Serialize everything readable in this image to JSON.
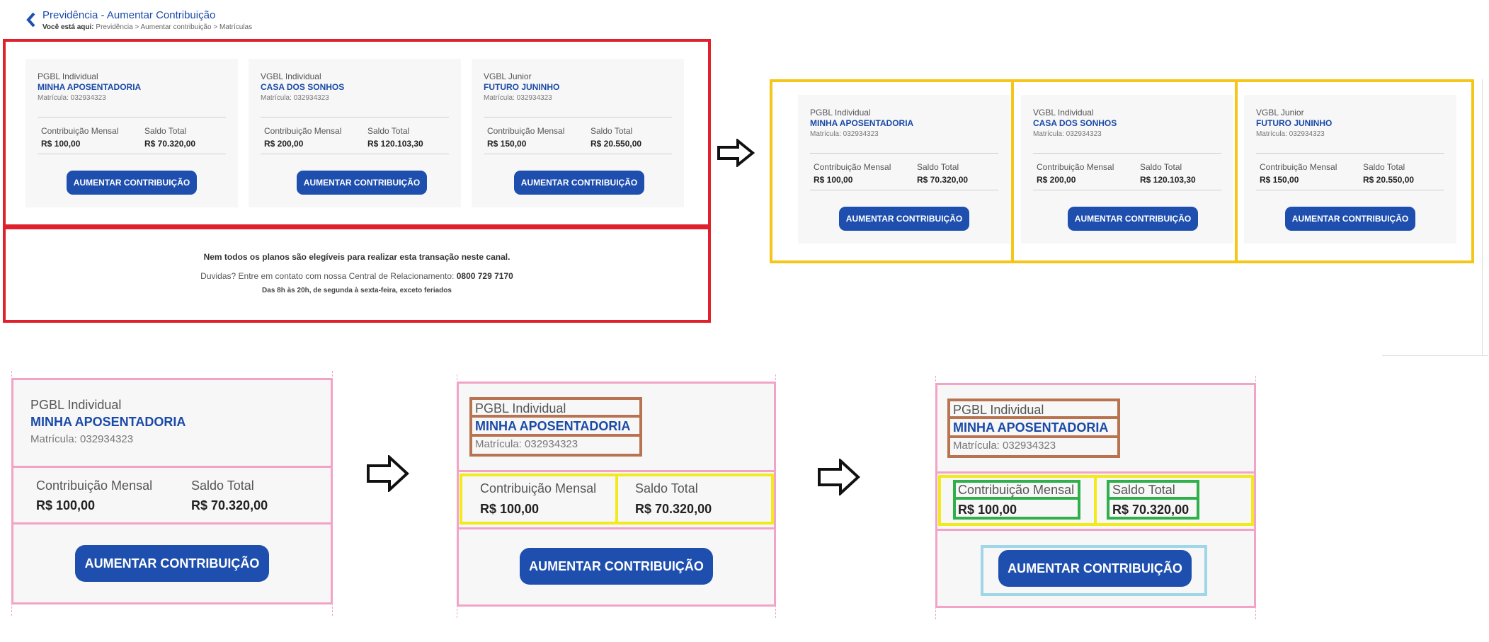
{
  "header": {
    "title": "Previdência - Aumentar Contribuição",
    "breadcrumb_prefix": "Você está aqui:",
    "breadcrumb_path": "Previdência > Aumentar contribuição > Matrículas"
  },
  "plans": [
    {
      "type": "PGBL Individual",
      "name": "MINHA APOSENTADORIA",
      "matricula": "Matrícula: 032934323",
      "contrib_label": "Contribuição Mensal",
      "contrib_value": "R$ 100,00",
      "saldo_label": "Saldo Total",
      "saldo_value": "R$ 70.320,00",
      "button": "AUMENTAR CONTRIBUIÇÃO"
    },
    {
      "type": "VGBL Individual",
      "name": "CASA DOS SONHOS",
      "matricula": "Matrícula: 032934323",
      "contrib_label": "Contribuição Mensal",
      "contrib_value": "R$ 200,00",
      "saldo_label": "Saldo Total",
      "saldo_value": "R$ 120.103,30",
      "button": "AUMENTAR CONTRIBUIÇÃO"
    },
    {
      "type": "VGBL Junior",
      "name": "FUTURO JUNINHO",
      "matricula": "Matrícula: 032934323",
      "contrib_label": "Contribuição Mensal",
      "contrib_value": "R$ 150,00",
      "saldo_label": "Saldo Total",
      "saldo_value": "R$ 20.550,00",
      "button": "AUMENTAR CONTRIBUIÇÃO"
    }
  ],
  "footer": {
    "notice": "Nem todos os planos são elegíveis para realizar esta transação neste canal.",
    "contact_prefix": "Duvidas? Entre em contato com nossa Central de Relacionamento:",
    "phone": "0800 729 7170",
    "hours": "Das 8h às 20h, de segunda à sexta-feira, exceto feriados"
  },
  "icons": {
    "back": "chevron-left-icon",
    "arrow": "arrow-right-icon"
  },
  "colors": {
    "brand_blue": "#1e4fae",
    "red_box": "#e0202a",
    "yellow_box": "#f5c518",
    "pink_box": "#f2a3c7",
    "brown_box": "#b87350",
    "lime_box": "#f2ea1a",
    "green_box": "#2fb04a",
    "cyan_box": "#9fd6e8"
  }
}
